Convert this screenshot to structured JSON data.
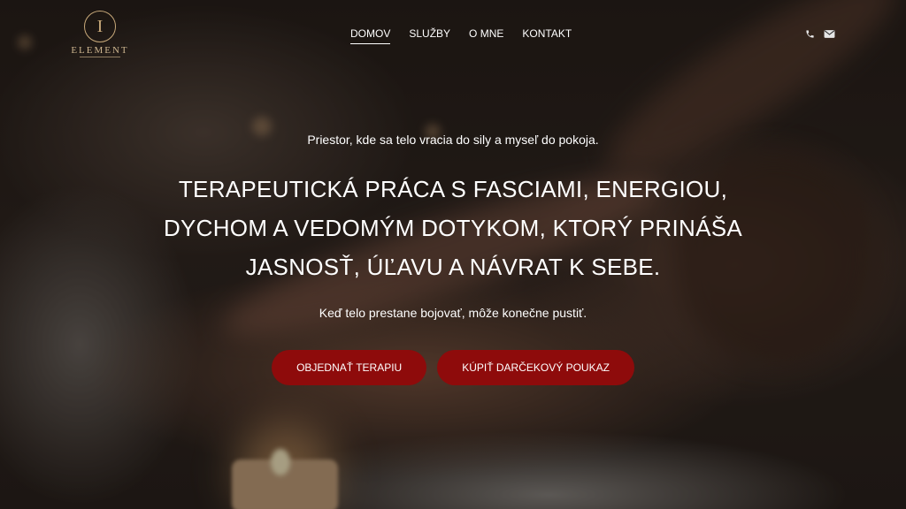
{
  "brand": {
    "name": "ELEMENT",
    "emblem_letter": "I"
  },
  "nav": {
    "items": [
      {
        "label": "DOMOV",
        "active": true
      },
      {
        "label": "SLUŽBY"
      },
      {
        "label": "O MNE"
      },
      {
        "label": "KONTAKT"
      }
    ],
    "icons": [
      "phone-icon",
      "mail-icon"
    ]
  },
  "hero": {
    "tagline": "Priestor, kde sa telo vracia do sily a myseľ do pokoja.",
    "headline": "TERAPEUTICKÁ PRÁCA S FASCIAMI, ENERGIOU, DYCHOM A VEDOMÝM DOTYKOM, KTORÝ PRINÁŠA JASNOSŤ, ÚĽAVU A NÁVRAT K SEBE.",
    "subline": "Keď telo prestane bojovať, môže konečne pustiť.",
    "buttons": {
      "primary": "OBJEDNAŤ TERAPIU",
      "secondary": "KÚPIŤ DARČEKOVÝ POUKAZ"
    }
  },
  "colors": {
    "accent": "#8e0b0b",
    "gold": "#c8a97a"
  }
}
